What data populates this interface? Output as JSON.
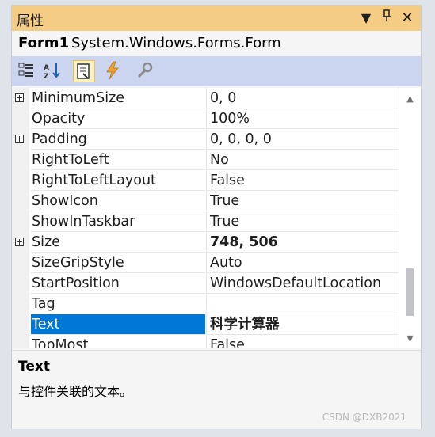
{
  "window": {
    "title": "属性",
    "dropdown_icon": "dropdown-triangle-icon",
    "pin_icon": "pin-icon",
    "close_icon": "close-icon"
  },
  "object": {
    "name": "Form1",
    "type": "System.Windows.Forms.Form"
  },
  "toolbar": {
    "buttons": [
      {
        "icon": "categorized-icon",
        "selected": false
      },
      {
        "icon": "alphabetical-sort-icon",
        "selected": false
      },
      {
        "icon": "properties-icon",
        "selected": true
      },
      {
        "icon": "events-lightning-icon",
        "selected": false
      },
      {
        "icon": "property-pages-wrench-icon",
        "selected": false
      }
    ]
  },
  "properties": [
    {
      "name": "MinimumSize",
      "value": "0, 0",
      "expandable": true,
      "bold": false
    },
    {
      "name": "Opacity",
      "value": "100%",
      "expandable": false,
      "bold": false
    },
    {
      "name": "Padding",
      "value": "0, 0, 0, 0",
      "expandable": true,
      "bold": false
    },
    {
      "name": "RightToLeft",
      "value": "No",
      "expandable": false,
      "bold": false
    },
    {
      "name": "RightToLeftLayout",
      "value": "False",
      "expandable": false,
      "bold": false
    },
    {
      "name": "ShowIcon",
      "value": "True",
      "expandable": false,
      "bold": false
    },
    {
      "name": "ShowInTaskbar",
      "value": "True",
      "expandable": false,
      "bold": false
    },
    {
      "name": "Size",
      "value": "748, 506",
      "expandable": true,
      "bold": true
    },
    {
      "name": "SizeGripStyle",
      "value": "Auto",
      "expandable": false,
      "bold": false
    },
    {
      "name": "StartPosition",
      "value": "WindowsDefaultLocation",
      "expandable": false,
      "bold": false
    },
    {
      "name": "Tag",
      "value": "",
      "expandable": false,
      "bold": false
    },
    {
      "name": "Text",
      "value": "科学计算器",
      "expandable": false,
      "bold": true,
      "selected": true
    },
    {
      "name": "TopMost",
      "value": "False",
      "expandable": false,
      "bold": false
    }
  ],
  "description": {
    "title": "Text",
    "text": "与控件关联的文本。"
  },
  "watermark": "CSDN @DXB2021",
  "colors": {
    "title_bar": "#f5cc84",
    "toolbar": "#ccd5f0",
    "selection": "#0078d7"
  }
}
